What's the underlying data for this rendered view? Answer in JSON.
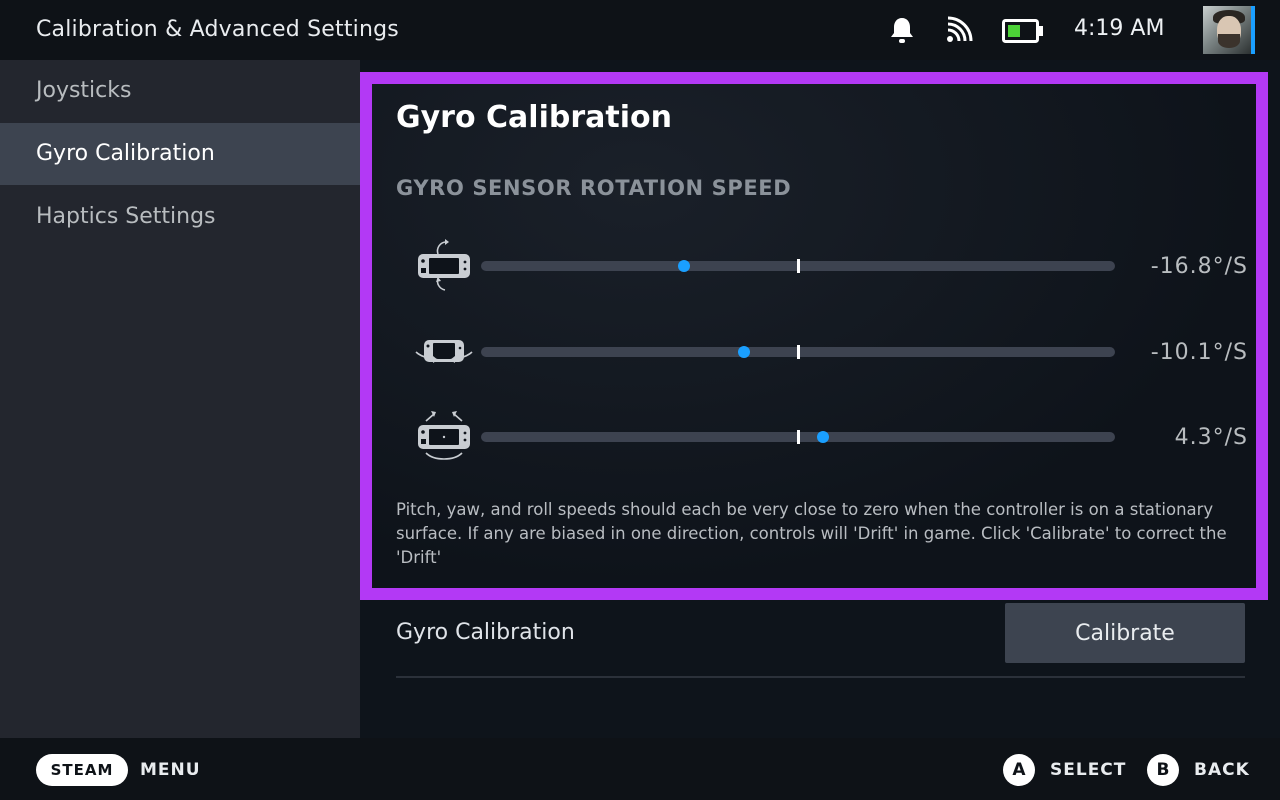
{
  "header": {
    "title": "Calibration & Advanced Settings",
    "clock": "4:19 AM",
    "icons": [
      "bell-icon",
      "wifi-icon",
      "battery-icon"
    ]
  },
  "sidebar": {
    "items": [
      {
        "label": "Joysticks",
        "active": false
      },
      {
        "label": "Gyro Calibration",
        "active": true
      },
      {
        "label": "Haptics Settings",
        "active": false
      }
    ]
  },
  "panel": {
    "title": "Gyro Calibration",
    "section_label": "GYRO SENSOR ROTATION SPEED",
    "rows": [
      {
        "axis_icon": "pitch-icon",
        "value": "-16.8°/S",
        "level": -0.36
      },
      {
        "axis_icon": "yaw-icon",
        "value": "-10.1°/S",
        "level": -0.17
      },
      {
        "axis_icon": "roll-icon",
        "value": "4.3°/S",
        "level": 0.08
      }
    ],
    "help_text": "Pitch, yaw, and roll speeds should each be very close to zero when the controller is on a stationary surface. If any are biased in one direction, controls will 'Drift' in game. Click 'Calibrate' to correct the 'Drift'"
  },
  "calibration": {
    "label": "Gyro Calibration",
    "button_label": "Calibrate"
  },
  "footer": {
    "steam_label": "STEAM",
    "menu_label": "MENU",
    "a_button": "A",
    "select_label": "SELECT",
    "b_button": "B",
    "back_label": "BACK"
  },
  "colors": {
    "accent": "#1a9fff",
    "focus_border": "#b339f5",
    "sidebar_bg": "#23262e",
    "active_item_bg": "#3d4450"
  }
}
